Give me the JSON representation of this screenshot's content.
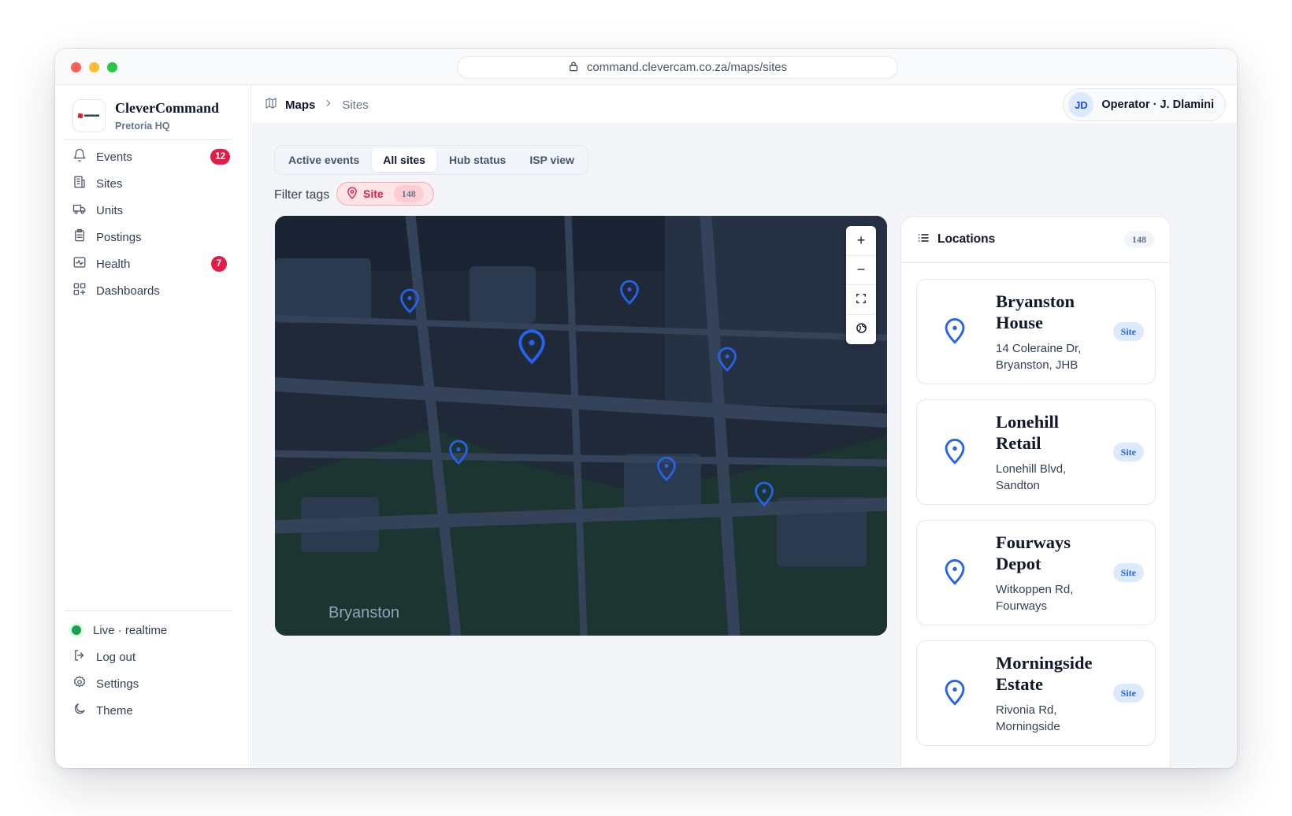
{
  "browser": {
    "url": "command.clevercam.co.za/maps/sites"
  },
  "brand": {
    "name": "CleverCommand",
    "subtitle": "Pretoria HQ"
  },
  "sidebar": {
    "items": [
      {
        "label": "Events",
        "icon": "bell-icon",
        "badge": "12"
      },
      {
        "label": "Sites",
        "icon": "building-icon",
        "badge": ""
      },
      {
        "label": "Units",
        "icon": "truck-icon",
        "badge": ""
      },
      {
        "label": "Postings",
        "icon": "clipboard-icon",
        "badge": ""
      },
      {
        "label": "Health",
        "icon": "activity-icon",
        "badge": "7"
      },
      {
        "label": "Dashboards",
        "icon": "dashboard-icon",
        "badge": ""
      }
    ],
    "footer": {
      "status": "Live · realtime",
      "logout": "Log out",
      "settings": "Settings",
      "theme": "Theme"
    }
  },
  "header": {
    "crumb_root": "Maps",
    "crumb_current": "Sites",
    "operator_initials": "JD",
    "operator_name": "Operator · J. Dlamini"
  },
  "tabs": [
    {
      "label": "Active events",
      "active": false
    },
    {
      "label": "All sites",
      "active": true
    },
    {
      "label": "Hub status",
      "active": false
    },
    {
      "label": "ISP view",
      "active": false
    }
  ],
  "filter": {
    "label": "Filter tags",
    "chip_label": "Site",
    "chip_count": "148"
  },
  "map": {
    "area_label": "Bryanston",
    "controls": [
      "+",
      "−",
      "fullscreen-icon",
      "globe-icon"
    ],
    "pin_color": "#2563eb"
  },
  "locations": {
    "title": "Locations",
    "count": "148",
    "items": [
      {
        "name": "Bryanston House",
        "address": "14 Coleraine Dr, Bryanston, JHB",
        "tag": "Site"
      },
      {
        "name": "Lonehill Retail",
        "address": "Lonehill Blvd, Sandton",
        "tag": "Site"
      },
      {
        "name": "Fourways Depot",
        "address": "Witkoppen Rd, Fourways",
        "tag": "Site"
      },
      {
        "name": "Morningside Estate",
        "address": "Rivonia Rd, Morningside",
        "tag": "Site"
      }
    ]
  },
  "colors": {
    "accent": "#2563eb",
    "alert": "#e11d48",
    "live": "#16a34a"
  }
}
